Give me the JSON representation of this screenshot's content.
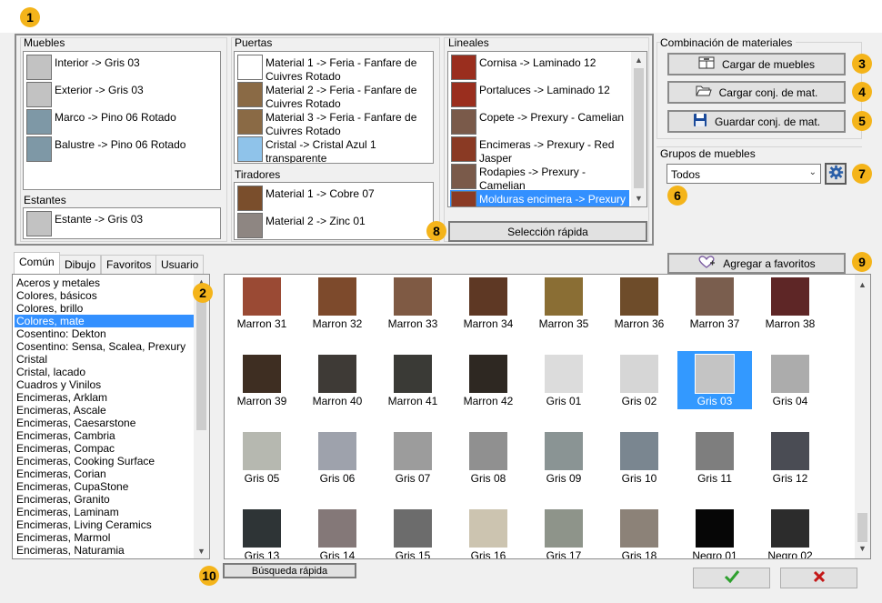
{
  "badges": [
    "1",
    "2",
    "3",
    "4",
    "5",
    "6",
    "7",
    "8",
    "9",
    "10"
  ],
  "muebles": {
    "title": "Muebles",
    "items": [
      {
        "label": "Interior -> Gris 03",
        "color": "#c2c2c2"
      },
      {
        "label": "Exterior -> Gris 03",
        "color": "#c2c2c2"
      },
      {
        "label": "Marco -> Pino 06 Rotado",
        "color": "#7e98a6"
      },
      {
        "label": "Balustre -> Pino 06 Rotado",
        "color": "#7e98a6"
      }
    ]
  },
  "estantes": {
    "title": "Estantes",
    "items": [
      {
        "label": "Estante -> Gris 03",
        "color": "#c2c2c2"
      }
    ]
  },
  "puertas": {
    "title": "Puertas",
    "items": [
      {
        "label": "Material 1 -> Feria - Fanfare de Cuivres Rotado",
        "color": "#ffffff"
      },
      {
        "label": "Material 2 -> Feria - Fanfare de Cuivres Rotado",
        "color": "#8a6a45"
      },
      {
        "label": "Material 3 -> Feria - Fanfare de Cuivres Rotado",
        "color": "#8a6a45"
      },
      {
        "label": "Cristal -> Cristal Azul 1 transparente",
        "color": "#8fc3ea"
      }
    ]
  },
  "tiradores": {
    "title": "Tiradores",
    "items": [
      {
        "label": "Material 1 -> Cobre 07",
        "color": "#7a4e2c"
      },
      {
        "label": "Material 2 -> Zinc 01",
        "color": "#8e8682"
      }
    ]
  },
  "lineales": {
    "title": "Lineales",
    "items": [
      {
        "label": "Cornisa -> Laminado 12",
        "color": "#9a2e1e"
      },
      {
        "label": "Portaluces -> Laminado 12",
        "color": "#9a2e1e"
      },
      {
        "label": "Copete -> Prexury - Camelian",
        "color": "#7a5a4a"
      },
      {
        "label": "Encimeras -> Prexury - Red Jasper",
        "color": "#8a3a24"
      },
      {
        "label": "Rodapies -> Prexury - Camelian",
        "color": "#7a5a4a"
      },
      {
        "label": "Molduras encimera -> Prexury - Red J",
        "color": "#8a3a24"
      }
    ]
  },
  "seleccion_rapida": "Selección rápida",
  "combinacion": {
    "title": "Combinación de materiales",
    "cargar_muebles": "Cargar de muebles",
    "cargar_conj": "Cargar conj. de mat.",
    "guardar_conj": "Guardar conj. de mat."
  },
  "grupos": {
    "title": "Grupos de muebles",
    "selected": "Todos"
  },
  "agregar_favoritos": "Agregar a favoritos",
  "tabs": [
    "Común",
    "Dibujo",
    "Favoritos",
    "Usuario"
  ],
  "categories": [
    "Aceros y metales",
    "Colores, básicos",
    "Colores, brillo",
    "Colores, mate",
    "Cosentino: Dekton",
    "Cosentino: Sensa, Scalea, Prexury",
    "Cristal",
    "Cristal, lacado",
    "Cuadros y Vinilos",
    "Encimeras, Arklam",
    "Encimeras, Ascale",
    "Encimeras, Caesarstone",
    "Encimeras, Cambria",
    "Encimeras, Compac",
    "Encimeras, Cooking Surface",
    "Encimeras, Corian",
    "Encimeras, CupaStone",
    "Encimeras, Granito",
    "Encimeras, Laminam",
    "Encimeras, Living Ceramics",
    "Encimeras, Marmol",
    "Encimeras, Naturamia"
  ],
  "selected_category_index": 3,
  "swatches": [
    {
      "name": "Marron 31",
      "color": "#9a4a34"
    },
    {
      "name": "Marron 32",
      "color": "#7d4a2c"
    },
    {
      "name": "Marron 33",
      "color": "#7f5a44"
    },
    {
      "name": "Marron 34",
      "color": "#5e3824"
    },
    {
      "name": "Marron 35",
      "color": "#8a6e34"
    },
    {
      "name": "Marron 36",
      "color": "#6e4c2a"
    },
    {
      "name": "Marron 37",
      "color": "#7a5e4e"
    },
    {
      "name": "Marron 38",
      "color": "#5e2626"
    },
    {
      "name": "Marron 39",
      "color": "#3e2e22"
    },
    {
      "name": "Marron 40",
      "color": "#3e3a36"
    },
    {
      "name": "Marron 41",
      "color": "#3a3a36"
    },
    {
      "name": "Marron 42",
      "color": "#2e2822"
    },
    {
      "name": "Gris 01",
      "color": "#dcdcdc"
    },
    {
      "name": "Gris 02",
      "color": "#d6d6d6"
    },
    {
      "name": "Gris 03",
      "color": "#c4c4c4"
    },
    {
      "name": "Gris 04",
      "color": "#acacac"
    },
    {
      "name": "Gris 05",
      "color": "#b6b8b0"
    },
    {
      "name": "Gris 06",
      "color": "#9ea2ac"
    },
    {
      "name": "Gris 07",
      "color": "#9c9c9c"
    },
    {
      "name": "Gris 08",
      "color": "#909090"
    },
    {
      "name": "Gris 09",
      "color": "#8a9494"
    },
    {
      "name": "Gris 10",
      "color": "#7a8690"
    },
    {
      "name": "Gris 11",
      "color": "#7e7e7e"
    },
    {
      "name": "Gris 12",
      "color": "#4a4c54"
    },
    {
      "name": "Gris 13",
      "color": "#2e3436"
    },
    {
      "name": "Gris 14",
      "color": "#847878"
    },
    {
      "name": "Gris 15",
      "color": "#6c6c6c"
    },
    {
      "name": "Gris 16",
      "color": "#ccc4b0"
    },
    {
      "name": "Gris 17",
      "color": "#8e948a"
    },
    {
      "name": "Gris 18",
      "color": "#8c8278"
    },
    {
      "name": "Negro 01",
      "color": "#060606"
    },
    {
      "name": "Negro 02",
      "color": "#2c2c2c"
    }
  ],
  "selected_swatch_index": 14,
  "busqueda_rapida": "Búsqueda rápida",
  "colors": {
    "accent": "#3390ff",
    "badge": "#f4b41a",
    "ok": "#2ea02e",
    "cancel": "#c41818",
    "gear": "#2a5fa8",
    "save": "#1a4a9a"
  }
}
